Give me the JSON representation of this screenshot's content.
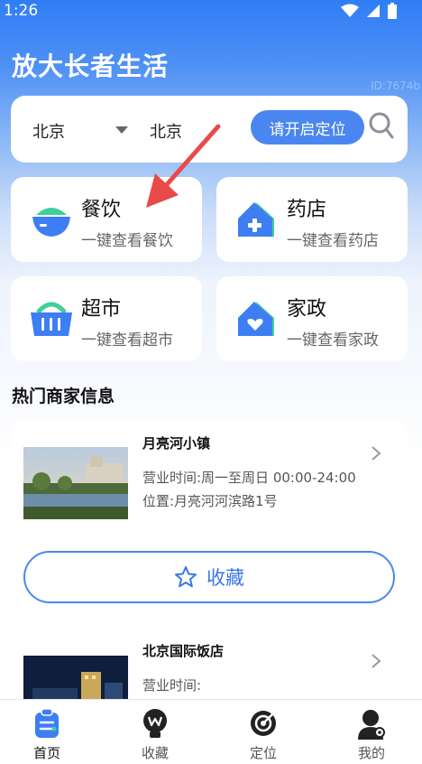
{
  "status_bar": {
    "time": "1:26"
  },
  "header": {
    "title": "放大长者生活",
    "watermark": "ID:7674b"
  },
  "location": {
    "province": "北京",
    "city": "北京",
    "locate_label": "请开启定位"
  },
  "categories": [
    {
      "title": "餐饮",
      "subtitle": "一键查看餐饮",
      "icon": "bowl-icon"
    },
    {
      "title": "药店",
      "subtitle": "一键查看药店",
      "icon": "pharmacy-icon"
    },
    {
      "title": "超市",
      "subtitle": "一键查看超市",
      "icon": "basket-icon"
    },
    {
      "title": "家政",
      "subtitle": "一键查看家政",
      "icon": "home-heart-icon"
    }
  ],
  "section": {
    "title": "热门商家信息"
  },
  "shops": [
    {
      "name": "月亮河小镇",
      "hours": "营业时间:周一至周日 00:00-24:00",
      "address": "位置:月亮河河滨路1号"
    },
    {
      "name": "北京国际饭店",
      "hours": "营业时间:"
    }
  ],
  "favorite": {
    "label": "收藏"
  },
  "tabs": [
    {
      "label": "首页",
      "icon": "home-list-icon",
      "active": true
    },
    {
      "label": "收藏",
      "icon": "bulb-icon",
      "active": false
    },
    {
      "label": "定位",
      "icon": "target-icon",
      "active": false
    },
    {
      "label": "我的",
      "icon": "profile-icon",
      "active": false
    }
  ],
  "colors": {
    "primary": "#4a86f0",
    "icon_green": "#3fcf9a",
    "annotation_red": "#e84a4a"
  }
}
